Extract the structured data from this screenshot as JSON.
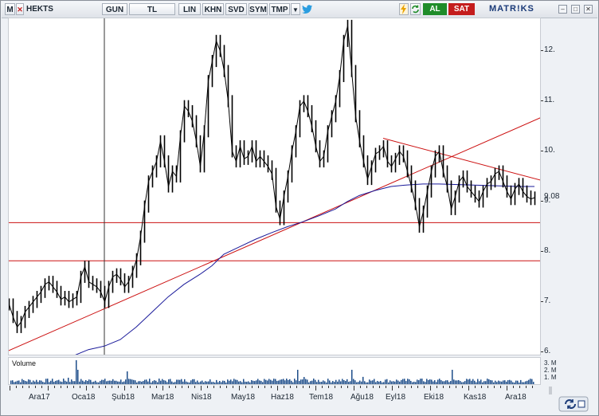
{
  "toolbar": {
    "m_label": "M",
    "symbol": "HEKTS",
    "period": "GUN",
    "currency": "TL",
    "scale_lin": "LIN",
    "khn": "KHN",
    "svd": "SVD",
    "sym": "SYM",
    "tmp": "TMP",
    "buy": "AL",
    "sell": "SAT",
    "brand": "MATR!KS"
  },
  "chart_data": {
    "type": "line",
    "title": "",
    "last_value_label": "9.08",
    "ylim": [
      5.95,
      12.65
    ],
    "y_ticks": [
      6,
      7,
      8,
      9,
      10,
      11,
      12
    ],
    "y_tick_labels": [
      "6.",
      "7.",
      "8.",
      "9.",
      "10.",
      "11.",
      "12."
    ],
    "x_tick_labels": [
      "Ara17",
      "Oca18",
      "Şub18",
      "Mar18",
      "Nis18",
      "May18",
      "Haz18",
      "Tem18",
      "Ağu18",
      "Eyl18",
      "Eki18",
      "Kas18",
      "Ara18"
    ],
    "horizontal_lines": [
      8.58,
      7.82
    ],
    "price_series": {
      "name": "",
      "x": [
        0,
        5,
        10,
        15,
        20,
        25,
        30,
        35,
        40,
        45,
        50,
        55,
        60,
        65,
        70,
        75,
        80,
        85,
        90,
        95,
        100,
        105,
        110,
        115,
        120,
        125,
        130,
        135,
        140,
        145,
        150,
        155,
        160,
        165,
        170,
        175,
        180,
        185,
        190,
        195,
        200,
        205,
        210,
        215,
        220,
        225,
        230,
        235,
        240,
        245,
        250,
        255,
        260,
        265,
        270,
        275,
        280,
        285,
        290,
        295,
        300,
        305,
        310,
        315,
        320,
        325,
        330,
        335,
        340,
        345,
        350,
        355,
        360,
        365,
        370,
        375,
        380,
        385,
        390,
        395,
        400,
        405,
        410,
        415,
        420,
        425,
        430,
        435,
        440,
        445,
        450,
        455,
        460,
        465,
        470,
        475,
        480,
        485,
        490,
        495,
        500,
        505,
        510,
        515,
        520,
        525,
        530,
        535,
        540,
        545,
        550,
        555,
        560,
        565,
        570,
        575,
        580,
        585,
        590,
        595,
        600,
        605,
        610,
        615,
        620,
        625,
        630,
        635,
        640,
        645,
        650,
        655,
        660
      ],
      "y": [
        6.95,
        6.7,
        6.5,
        6.6,
        6.8,
        6.9,
        7.0,
        7.1,
        7.2,
        7.35,
        7.4,
        7.3,
        7.2,
        7.05,
        7.1,
        7.0,
        7.05,
        7.1,
        7.5,
        7.7,
        7.4,
        7.35,
        7.3,
        7.2,
        7.0,
        7.3,
        7.5,
        7.55,
        7.45,
        7.3,
        7.4,
        7.6,
        7.85,
        8.3,
        8.9,
        9.4,
        9.6,
        9.8,
        10.2,
        9.8,
        9.3,
        9.6,
        9.5,
        10.3,
        10.9,
        10.8,
        10.6,
        10.2,
        9.7,
        10.4,
        11.4,
        11.8,
        12.2,
        12.0,
        11.6,
        11.0,
        10.0,
        9.8,
        10.1,
        9.85,
        9.9,
        10.1,
        9.8,
        9.9,
        9.8,
        9.7,
        9.55,
        8.9,
        8.65,
        9.1,
        9.5,
        10.0,
        10.4,
        10.9,
        11.0,
        10.8,
        10.5,
        10.1,
        9.8,
        9.9,
        10.4,
        10.7,
        11.0,
        11.5,
        12.2,
        12.5,
        11.6,
        10.7,
        10.2,
        9.8,
        9.45,
        9.7,
        9.95,
        10.0,
        10.1,
        9.8,
        9.7,
        9.85,
        10.0,
        9.9,
        9.6,
        9.3,
        8.95,
        8.5,
        8.8,
        9.2,
        9.6,
        9.9,
        10.0,
        9.6,
        9.3,
        8.85,
        9.1,
        9.4,
        9.5,
        9.3,
        9.2,
        9.1,
        9.0,
        9.2,
        9.35,
        9.4,
        9.55,
        9.6,
        9.4,
        9.2,
        9.05,
        9.25,
        9.35,
        9.2,
        9.1,
        9.05,
        9.08
      ]
    },
    "moving_average": [
      [
        80,
        5.92
      ],
      [
        100,
        6.05
      ],
      [
        120,
        6.12
      ],
      [
        140,
        6.25
      ],
      [
        160,
        6.5
      ],
      [
        180,
        6.8
      ],
      [
        200,
        7.1
      ],
      [
        220,
        7.35
      ],
      [
        240,
        7.55
      ],
      [
        255,
        7.72
      ],
      [
        270,
        7.95
      ],
      [
        290,
        8.1
      ],
      [
        310,
        8.25
      ],
      [
        330,
        8.38
      ],
      [
        350,
        8.5
      ],
      [
        370,
        8.6
      ],
      [
        390,
        8.72
      ],
      [
        410,
        8.85
      ],
      [
        425,
        9.0
      ],
      [
        440,
        9.12
      ],
      [
        460,
        9.22
      ],
      [
        480,
        9.3
      ],
      [
        500,
        9.33
      ],
      [
        520,
        9.35
      ],
      [
        540,
        9.35
      ],
      [
        560,
        9.34
      ],
      [
        580,
        9.33
      ],
      [
        600,
        9.32
      ],
      [
        620,
        9.31
      ],
      [
        640,
        9.3
      ],
      [
        660,
        9.3
      ]
    ],
    "trendlines": [
      {
        "from": [
          0,
          6.03
        ],
        "to": [
          669,
          10.68
        ]
      },
      {
        "from": [
          470,
          10.26
        ],
        "to": [
          669,
          9.42
        ]
      }
    ],
    "cursor_x": 120,
    "volume": {
      "title": "Volume",
      "axis_labels": [
        "3. M",
        "2. M",
        "1. M"
      ]
    }
  },
  "colors": {
    "price": "#000000",
    "moving_average": "#1a1a9a",
    "trendline": "#cc1010",
    "volume": "#1d4d8a",
    "buy": "#1f8c2a",
    "sell": "#c41d1d"
  },
  "icons": [
    "twitter-icon",
    "lightning-icon",
    "refresh-icon"
  ]
}
